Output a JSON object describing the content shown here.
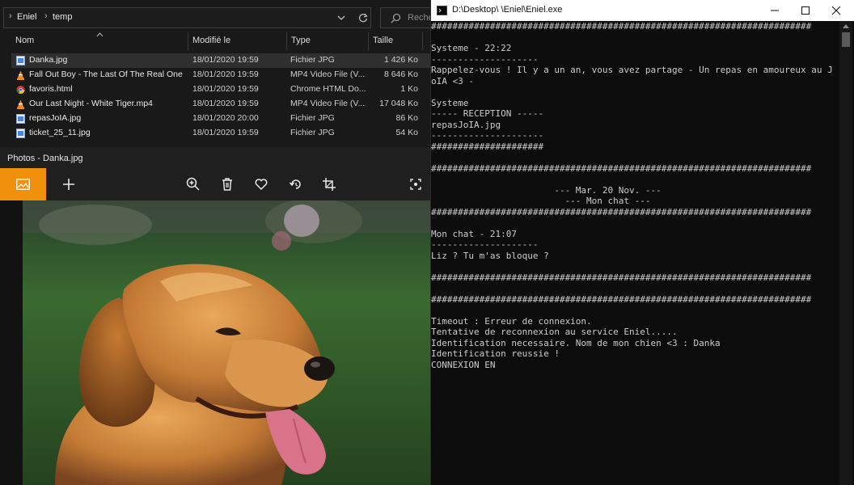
{
  "explorer": {
    "breadcrumb": [
      "Eniel",
      "temp"
    ],
    "search_placeholder": "Reche",
    "columns": {
      "name": "Nom",
      "modified": "Modifié le",
      "type": "Type",
      "size": "Taille"
    },
    "files": [
      {
        "name": "Danka.jpg",
        "modified": "18/01/2020 19:59",
        "type": "Fichier JPG",
        "size": "1 426 Ko",
        "icon": "image-file-icon",
        "selected": true
      },
      {
        "name": "Fall Out Boy - The Last Of The Real Ones....",
        "modified": "18/01/2020 19:59",
        "type": "MP4 Video File (V...",
        "size": "8 646 Ko",
        "icon": "vlc-cone-icon"
      },
      {
        "name": "favoris.html",
        "modified": "18/01/2020 19:59",
        "type": "Chrome HTML Do...",
        "size": "1 Ko",
        "icon": "chrome-icon"
      },
      {
        "name": "Our Last Night - White Tiger.mp4",
        "modified": "18/01/2020 19:59",
        "type": "MP4 Video File (V...",
        "size": "17 048 Ko",
        "icon": "vlc-cone-icon"
      },
      {
        "name": "repasJoIA.jpg",
        "modified": "18/01/2020 20:00",
        "type": "Fichier JPG",
        "size": "86 Ko",
        "icon": "image-file-icon"
      },
      {
        "name": "ticket_25_11.jpg",
        "modified": "18/01/2020 19:59",
        "type": "Fichier JPG",
        "size": "54 Ko",
        "icon": "image-file-icon"
      }
    ]
  },
  "photos": {
    "title": "Photos - Danka.jpg",
    "toolbar_icons": [
      "image-icon",
      "add-icon",
      "zoom-in-icon",
      "delete-icon",
      "favorite-icon",
      "rotate-icon",
      "crop-icon",
      "fit-screen-icon"
    ],
    "accent": "#f0900c"
  },
  "console": {
    "title": "D:\\Desktop\\   \\Eniel\\Eniel.exe",
    "lines": [
      "#######################################################################",
      "",
      "Systeme - 22:22",
      "--------------------",
      "Rappelez-vous ! Il y a un an, vous avez partage - Un repas en amoureux au J",
      "oIA <3 -",
      "",
      "Systeme",
      "----- RECEPTION -----",
      "repasJoIA.jpg",
      "---------------------",
      "#####################",
      "",
      "#######################################################################",
      "",
      "                       --- Mar. 20 Nov. ---",
      "                         --- Mon chat ---",
      "#######################################################################",
      "",
      "Mon chat - 21:07",
      "--------------------",
      "Liz ? Tu m'as bloque ?",
      "",
      "#######################################################################",
      "",
      "#######################################################################",
      "",
      "Timeout : Erreur de connexion.",
      "Tentative de reconnexion au service Eniel.....",
      "Identification necessaire. Nom de mon chien <3 : Danka",
      "Identification reussie !",
      "CONNEXION EN"
    ]
  }
}
